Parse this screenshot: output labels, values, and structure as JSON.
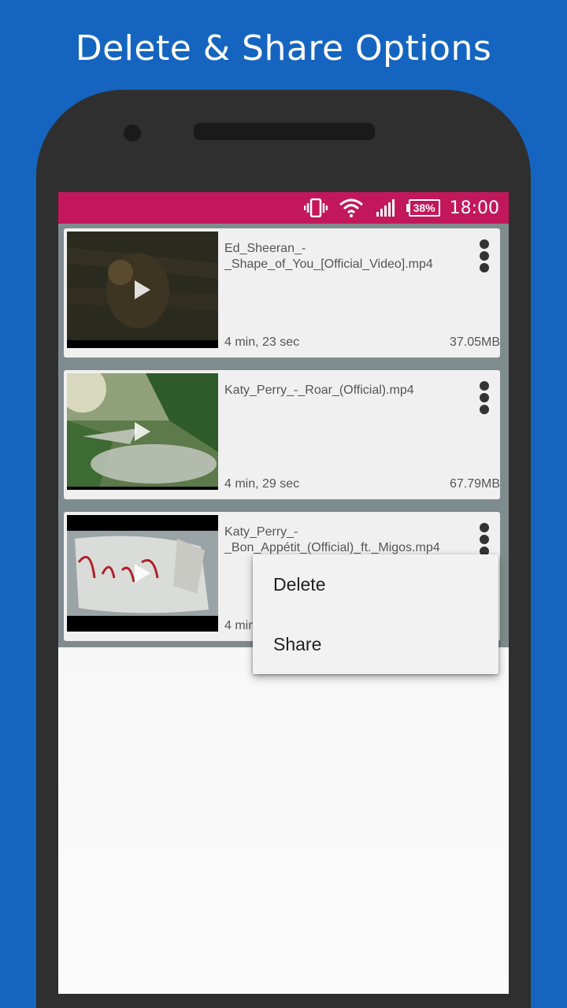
{
  "promo": {
    "title": "Delete & Share Options"
  },
  "status_bar": {
    "battery_level": "38%",
    "time": "18:00"
  },
  "videos": [
    {
      "title_line1": "Ed_Sheeran_-",
      "title_line2": "_Shape_of_You_[Official_Video].mp4",
      "duration": "4 min, 23 sec",
      "size": "37.05MB"
    },
    {
      "title_line1": "Katy_Perry_-_Roar_(Official).mp4",
      "title_line2": "",
      "duration": "4 min, 29 sec",
      "size": "67.79MB"
    },
    {
      "title_line1": "Katy_Perry_-",
      "title_line2": "_Bon_Appétit_(Official)_ft._Migos.mp4",
      "duration": "4 min, 25 sec",
      "size": ""
    }
  ],
  "menu": {
    "delete_label": "Delete",
    "share_label": "Share"
  },
  "colors": {
    "background": "#1565c0",
    "status_bar": "#c2185b",
    "list_bg": "#7f8c8d"
  }
}
